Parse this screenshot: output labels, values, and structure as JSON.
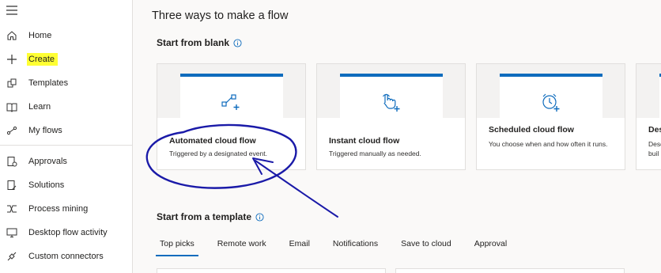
{
  "sidebar": {
    "items": [
      {
        "label": "Home"
      },
      {
        "label": "Create"
      },
      {
        "label": "Templates"
      },
      {
        "label": "Learn"
      },
      {
        "label": "My flows"
      },
      {
        "label": "Approvals"
      },
      {
        "label": "Solutions"
      },
      {
        "label": "Process mining"
      },
      {
        "label": "Desktop flow activity"
      },
      {
        "label": "Custom connectors"
      }
    ]
  },
  "main": {
    "title": "Three ways to make a flow",
    "blank_section": "Start from blank",
    "template_section": "Start from a template",
    "cards": [
      {
        "title": "Automated cloud flow",
        "desc": "Triggered by a designated event."
      },
      {
        "title": "Instant cloud flow",
        "desc": "Triggered manually as needed."
      },
      {
        "title": "Scheduled cloud flow",
        "desc": "You choose when and how often it runs."
      },
      {
        "title": "Des",
        "desc": "Desc buil"
      }
    ],
    "tabs": [
      {
        "label": "Top picks"
      },
      {
        "label": "Remote work"
      },
      {
        "label": "Email"
      },
      {
        "label": "Notifications"
      },
      {
        "label": "Save to cloud"
      },
      {
        "label": "Approval"
      }
    ]
  },
  "colors": {
    "accent": "#0f6cbd",
    "highlight": "#ffff33",
    "annotation_ink": "#1a1aa8"
  }
}
